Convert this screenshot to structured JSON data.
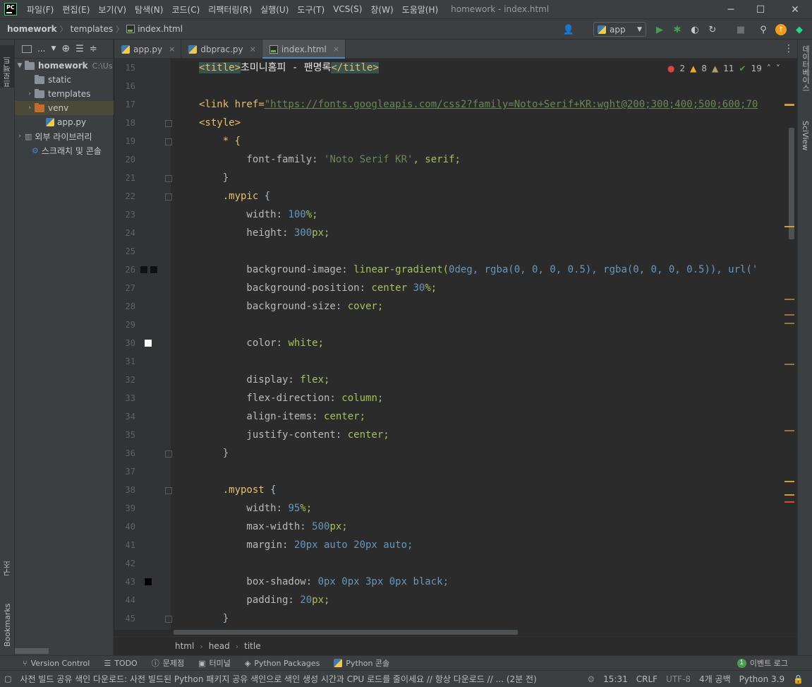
{
  "menu": [
    "파일(F)",
    "편집(E)",
    "보기(V)",
    "탐색(N)",
    "코드(C)",
    "리팩터링(R)",
    "실행(U)",
    "도구(T)",
    "VCS(S)",
    "창(W)",
    "도움말(H)"
  ],
  "window_title": "homework - index.html",
  "nav": {
    "project": "homework",
    "folder": "templates",
    "file": "index.html"
  },
  "run_config": "app",
  "project_panel": {
    "header_dots": "...",
    "items": [
      {
        "label": "homework",
        "path": "C:\\Us"
      },
      {
        "label": "static"
      },
      {
        "label": "templates"
      },
      {
        "label": "venv"
      },
      {
        "label": "app.py"
      },
      {
        "label": "외부 라이브러리"
      },
      {
        "label": "스크래치 및 콘솔"
      }
    ]
  },
  "left_strip": {
    "project": "프로젝트",
    "structure": "구조",
    "bookmarks": "Bookmarks"
  },
  "right_strip": {
    "database": "데이터베이스",
    "sciview": "SciView"
  },
  "tabs": [
    {
      "label": "app.py",
      "close": "×"
    },
    {
      "label": "dbprac.py",
      "close": "×"
    },
    {
      "label": "index.html",
      "close": "×"
    }
  ],
  "inspection": {
    "errors": "2",
    "warnings": "8",
    "weak": "11",
    "ok": "19"
  },
  "editor_lines": {
    "l15": "15",
    "l16": "16",
    "l17": "17",
    "l18": "18",
    "l19": "19",
    "l20": "20",
    "l21": "21",
    "l22": "22",
    "l23": "23",
    "l24": "24",
    "l25": "25",
    "l26": "26",
    "l27": "27",
    "l28": "28",
    "l29": "29",
    "l30": "30",
    "l31": "31",
    "l32": "32",
    "l33": "33",
    "l34": "34",
    "l35": "35",
    "l36": "36",
    "l37": "37",
    "l38": "38",
    "l39": "39",
    "l40": "40",
    "l41": "41",
    "l42": "42",
    "l43": "43",
    "l44": "44",
    "l45": "45"
  },
  "code": {
    "title_open": "<title>",
    "title_text": "초미니홈피 - 팬명록",
    "title_close": "</title>",
    "link_open": "<link href=",
    "link_url": "\"https://fonts.googleapis.com/css2?family=Noto+Serif+KR:wght@200;300;400;500;600;70",
    "style_open": "<style>",
    "l19": "    * {",
    "l20_prop": "        font-family: ",
    "l20_val": "'Noto Serif KR'",
    "l20_rest": ", serif;",
    "brace_close": "    }",
    "l22_sel": ".mypic",
    "l23_prop": "        width: ",
    "l23_num": "100",
    "l23_unit": "%;",
    "l24_prop": "        height: ",
    "l24_num": "300",
    "l24_unit": "px;",
    "l26_prop": "        background-image: ",
    "l26_val": "linear-gradient(",
    "l26_rest": "0deg, rgba(0, 0, 0, 0.5), rgba(0, 0, 0, 0.5)), url('",
    "l27_prop": "        background-position: ",
    "l27_val": "center ",
    "l27_num": "30",
    "l27_unit": "%;",
    "l28_prop": "        background-size: ",
    "l28_val": "cover;",
    "l30_prop": "        color: ",
    "l30_val": "white;",
    "l32_prop": "        display: ",
    "l32_val": "flex;",
    "l33_prop": "        flex-direction: ",
    "l33_val": "column;",
    "l34_prop": "        align-items: ",
    "l34_val": "center;",
    "l35_prop": "        justify-content: ",
    "l35_val": "center;",
    "l38_sel": ".mypost",
    "l39_prop": "        width: ",
    "l39_num": "95",
    "l39_unit": "%;",
    "l40_prop": "        max-width: ",
    "l40_num": "500",
    "l40_unit": "px;",
    "l41_prop": "        margin: ",
    "l41_val": "20px auto 20px auto;",
    "l43_prop": "        box-shadow: ",
    "l43_val": "0px 0px 3px 0px black;",
    "l44_prop": "        padding: ",
    "l44_num": "20",
    "l44_unit": "px;"
  },
  "breadcrumb": [
    "html",
    "head",
    "title"
  ],
  "toolwindows": [
    "Version Control",
    "TODO",
    "문제점",
    "터미널",
    "Python Packages",
    "Python 콘솔"
  ],
  "event_log": {
    "count": "1",
    "label": "이벤트 로그"
  },
  "status": {
    "message": "사전 빌드 공유 색인 다운로드: 사전 빌드된 Python 패키지 공유 색인으로 색인 생성 시간과 CPU 로드를 줄이세요 // 항상 다운로드 // ... (2분 전)",
    "position": "15:31",
    "line_sep": "CRLF",
    "encoding": "UTF-8",
    "indent": "4개 공백",
    "interpreter": "Python 3.9"
  },
  "colors": {
    "accent": "#4a88c7",
    "selection": "#4b4a38",
    "editor_bg": "#2b2b2b",
    "chrome_bg": "#3c3f41"
  }
}
